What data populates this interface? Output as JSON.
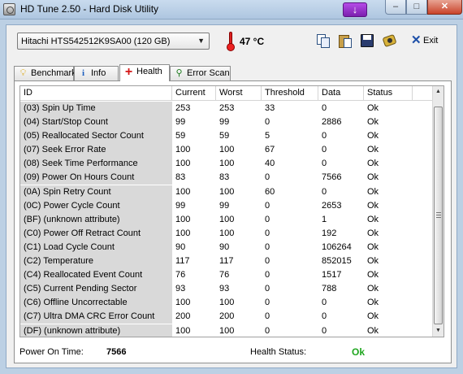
{
  "window": {
    "title": "HD Tune 2.50 - Hard Disk Utility",
    "tray_button_glyph": "↓",
    "minimize_glyph": "–",
    "maximize_glyph": "□",
    "close_glyph": "✕"
  },
  "toolbar": {
    "drive": "Hitachi HTS542512K9SA00 (120 GB)",
    "temperature": "47 °C",
    "exit_label": "Exit",
    "icons": [
      "copy-icon",
      "paste-icon",
      "save-icon",
      "screenshot-icon",
      "thermometer-icon",
      "exit-icon"
    ]
  },
  "tabs": [
    {
      "label": "Benchmark",
      "icon": "bulb-icon",
      "active": false
    },
    {
      "label": "Info",
      "icon": "info-icon",
      "active": false
    },
    {
      "label": "Health",
      "icon": "health-cross-icon",
      "active": true
    },
    {
      "label": "Error Scan",
      "icon": "magnifier-icon",
      "active": false
    }
  ],
  "table": {
    "columns": [
      "ID",
      "Current",
      "Worst",
      "Threshold",
      "Data",
      "Status"
    ],
    "rows": [
      [
        "(03) Spin Up Time",
        "253",
        "253",
        "33",
        "0",
        "Ok"
      ],
      [
        "(04) Start/Stop Count",
        "99",
        "99",
        "0",
        "2886",
        "Ok"
      ],
      [
        "(05) Reallocated Sector Count",
        "59",
        "59",
        "5",
        "0",
        "Ok"
      ],
      [
        "(07) Seek Error Rate",
        "100",
        "100",
        "67",
        "0",
        "Ok"
      ],
      [
        "(08) Seek Time Performance",
        "100",
        "100",
        "40",
        "0",
        "Ok"
      ],
      [
        "(09) Power On Hours Count",
        "83",
        "83",
        "0",
        "7566",
        "Ok"
      ],
      [
        "(0A) Spin Retry Count",
        "100",
        "100",
        "60",
        "0",
        "Ok"
      ],
      [
        "(0C) Power Cycle Count",
        "99",
        "99",
        "0",
        "2653",
        "Ok"
      ],
      [
        "(BF) (unknown attribute)",
        "100",
        "100",
        "0",
        "1",
        "Ok"
      ],
      [
        "(C0) Power Off Retract Count",
        "100",
        "100",
        "0",
        "192",
        "Ok"
      ],
      [
        "(C1) Load Cycle Count",
        "90",
        "90",
        "0",
        "106264",
        "Ok"
      ],
      [
        "(C2) Temperature",
        "117",
        "117",
        "0",
        "852015",
        "Ok"
      ],
      [
        "(C4) Reallocated Event Count",
        "76",
        "76",
        "0",
        "1517",
        "Ok"
      ],
      [
        "(C5) Current Pending Sector",
        "93",
        "93",
        "0",
        "788",
        "Ok"
      ],
      [
        "(C6) Offline Uncorrectable",
        "100",
        "100",
        "0",
        "0",
        "Ok"
      ],
      [
        "(C7) Ultra DMA CRC Error Count",
        "200",
        "200",
        "0",
        "0",
        "Ok"
      ],
      [
        "(DF) (unknown attribute)",
        "100",
        "100",
        "0",
        "0",
        "Ok"
      ]
    ]
  },
  "footer": {
    "power_on_label": "Power On Time:",
    "power_on_value": "7566",
    "health_label": "Health Status:",
    "health_value": "Ok",
    "health_color": "#1fa61f"
  }
}
